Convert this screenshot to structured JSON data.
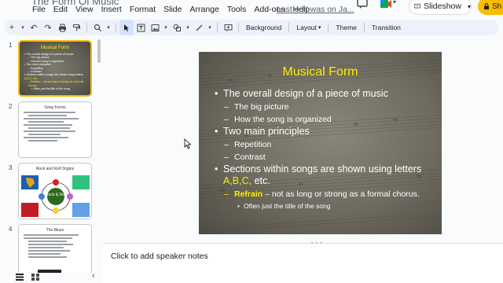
{
  "header": {
    "title": "The Form Of Music",
    "menu": [
      "File",
      "Edit",
      "View",
      "Insert",
      "Format",
      "Slide",
      "Arrange",
      "Tools",
      "Add-ons",
      "Help"
    ],
    "last_edit": "Last edit was on Ja...",
    "slideshow_label": "Slideshow",
    "share_label": "Sh"
  },
  "toolbar": {
    "background_label": "Background",
    "layout_label": "Layout",
    "theme_label": "Theme",
    "transition_label": "Transition"
  },
  "filmstrip": {
    "slides": [
      {
        "number": "1",
        "title": "Musical Form",
        "lines": [
          "• The overall design of a piece of music",
          "– The big picture",
          "– How the song is organized",
          "• Two main principles",
          "– Repetition",
          "– Contrast",
          "• Sections within songs are shown using letters",
          "A,B,C, etc.",
          "– Refrain – not as long or strong as a formal chorus.",
          "• Often just the title of the song"
        ]
      },
      {
        "number": "2",
        "title": "Song Forms"
      },
      {
        "number": "3",
        "title": "Rock and Roll Origins",
        "center_label": "Rock & Roll"
      },
      {
        "number": "4",
        "title": "The Blues"
      }
    ]
  },
  "slide": {
    "title": "Musical Form",
    "bullets": {
      "b1": "The overall design of a piece of music",
      "b1a": "The big picture",
      "b1b": "How the song is organized",
      "b2": "Two main principles",
      "b2a": "Repetition",
      "b2b": "Contrast",
      "b3_text": "Sections within songs are shown using letters ",
      "b3_letters": "A,B,C,",
      "b3_tail": " etc.",
      "b3a_term": "Refrain",
      "b3a_rest": " – not as long or strong as a formal chorus.",
      "b3a_sub": "Often just the title of the song"
    }
  },
  "notes": {
    "placeholder": "Click to add speaker notes"
  },
  "colors": {
    "accent_yellow": "#ffee00",
    "selection_border": "#fbbc04",
    "share_button": "#fbbc04"
  }
}
